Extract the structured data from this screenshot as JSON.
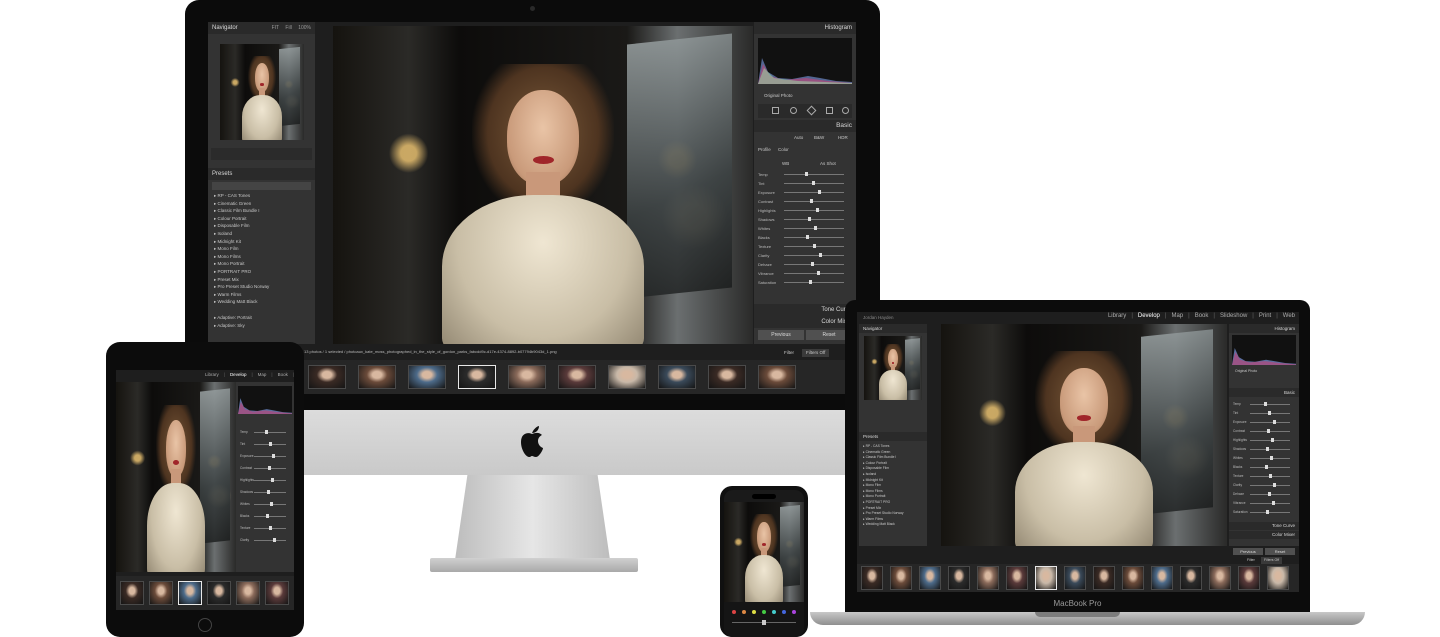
{
  "imac": {
    "navigator": {
      "title": "Navigator",
      "tabs": [
        "FIT",
        "Fill",
        "100%"
      ]
    },
    "presets": {
      "title": "Presets",
      "items": [
        "RP - CAS Tones",
        "Cinematic Green",
        "Classic Film Bundle I",
        "Colour Portrait",
        "Disposable Film",
        "Isoland",
        "Midnight Kit",
        "Mono Film",
        "Mono Films",
        "Mono Portrait",
        "PORTRAIT PRO",
        "Preset Mix",
        "Pro Preset Studio Norway",
        "Warm Films",
        "Wedding Matt Black"
      ],
      "extra": [
        "Adaptive: Portrait",
        "Adaptive: Sky"
      ]
    },
    "histogram": {
      "title": "Histogram",
      "original_photo": "Original Photo"
    },
    "basic": {
      "title": "Basic",
      "auto": "Auto",
      "bw": "B&W",
      "hdr": "HDR",
      "profile_label": "Profile",
      "profile_value": "Color",
      "wb_label": "WB",
      "wb_value": "As Shot",
      "tone_sliders": [
        "Temp",
        "Tint"
      ],
      "tone_title": "Tone",
      "light_sliders": [
        "Exposure",
        "Contrast",
        "Highlights",
        "Shadows",
        "Whites",
        "Blacks"
      ],
      "presence_title": "Presence",
      "presence_sliders": [
        "Texture",
        "Clarity",
        "Dehaze"
      ],
      "color_sliders": [
        "Vibrance",
        "Saturation"
      ]
    },
    "tone_curve": "Tone Curve",
    "color_mixer": "Color Mixer",
    "previous": "Previous",
    "reset": "Reset",
    "filmstrip_info": "13 photos / 1 selected / photoaux_kate_moss_photographed_in_the_style_of_gordon_parks_fabcdd9c-d17e-4374-8892-b07794b9043d_1.png",
    "filter_label": "Filter",
    "filter_value": "Filters Off"
  },
  "macbook": {
    "modules": [
      "Library",
      "Develop",
      "Map",
      "Book",
      "Slideshow",
      "Print",
      "Web"
    ],
    "active_module": "Develop",
    "identity": "Jordan Hayden",
    "navigator": "Navigator",
    "histogram": "Histogram",
    "original_photo": "Original Photo",
    "basic": "Basic",
    "presets": "Presets",
    "tone_curve": "Tone Curve",
    "color_mixer": "Color Mixer",
    "previous": "Previous",
    "reset": "Reset",
    "filter_label": "Filter",
    "filter_value": "Filters Off",
    "label": "MacBook Pro"
  },
  "ipad": {
    "modules": [
      "Library",
      "Develop",
      "Map",
      "Book",
      "Slideshow"
    ],
    "active_module": "Develop"
  },
  "colors": {
    "panel": "#333333",
    "panel_header": "#2a2a2a",
    "app_bg": "#1e1e1e",
    "text": "#cfcfcf",
    "device": "#0b0b0b"
  }
}
